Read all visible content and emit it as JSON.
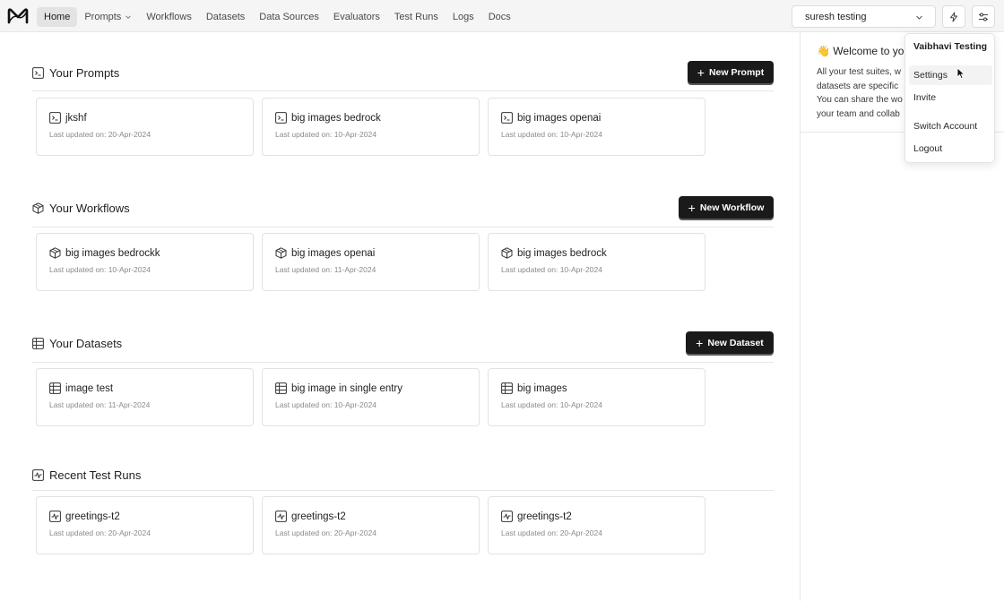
{
  "nav": {
    "items": [
      {
        "label": "Home",
        "active": true
      },
      {
        "label": "Prompts",
        "has_dropdown": true
      },
      {
        "label": "Workflows"
      },
      {
        "label": "Datasets"
      },
      {
        "label": "Data Sources"
      },
      {
        "label": "Evaluators"
      },
      {
        "label": "Test Runs"
      },
      {
        "label": "Logs"
      },
      {
        "label": "Docs"
      }
    ],
    "account_select": "suresh testing"
  },
  "sections": {
    "prompts": {
      "title": "Your Prompts",
      "button": "New Prompt",
      "cards": [
        {
          "title": "jkshf",
          "updated": "Last updated on: 20-Apr-2024"
        },
        {
          "title": "big images bedrock",
          "updated": "Last updated on: 10-Apr-2024"
        },
        {
          "title": "big images openai",
          "updated": "Last updated on: 10-Apr-2024"
        }
      ]
    },
    "workflows": {
      "title": "Your Workflows",
      "button": "New Workflow",
      "cards": [
        {
          "title": "big images bedrockk",
          "updated": "Last updated on: 10-Apr-2024"
        },
        {
          "title": "big images openai",
          "updated": "Last updated on: 11-Apr-2024"
        },
        {
          "title": "big images bedrock",
          "updated": "Last updated on: 10-Apr-2024"
        }
      ]
    },
    "datasets": {
      "title": "Your Datasets",
      "button": "New Dataset",
      "cards": [
        {
          "title": "image test",
          "updated": "Last updated on: 11-Apr-2024"
        },
        {
          "title": "big image in single entry",
          "updated": "Last updated on: 10-Apr-2024"
        },
        {
          "title": "big images",
          "updated": "Last updated on: 10-Apr-2024"
        }
      ]
    },
    "test_runs": {
      "title": "Recent Test Runs",
      "cards": [
        {
          "title": "greetings-t2",
          "updated": "Last updated on: 20-Apr-2024"
        },
        {
          "title": "greetings-t2",
          "updated": "Last updated on: 20-Apr-2024"
        },
        {
          "title": "greetings-t2",
          "updated": "Last updated on: 20-Apr-2024"
        }
      ]
    }
  },
  "welcome": {
    "emoji": "👋",
    "title": "Welcome to you",
    "lines": [
      "All your test suites, w",
      "datasets are specific",
      "You can share the wo",
      "your team and collab"
    ]
  },
  "user_menu": {
    "header": "Vaibhavi Testing",
    "items": [
      {
        "label": "Settings",
        "hovered": true
      },
      {
        "label": "Invite"
      },
      {
        "label": "Switch Account"
      },
      {
        "label": "Logout"
      }
    ]
  },
  "colors": {
    "button_bg": "#1a1a1a",
    "topbar_bg": "#f5f5f5",
    "active_tab_bg": "#e3e3e3"
  }
}
